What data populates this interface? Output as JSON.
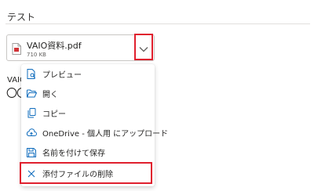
{
  "compose": {
    "subject": "テスト",
    "body_line1": "VAIO",
    "body_line2": "〇〇"
  },
  "attachment": {
    "name": "VAIO資料.pdf",
    "size": "710 KB",
    "icon": "pdf-file-icon"
  },
  "menu": {
    "items": [
      {
        "label": "プレビュー",
        "icon": "preview-icon"
      },
      {
        "label": "開く",
        "icon": "folder-open-icon"
      },
      {
        "label": "コピー",
        "icon": "copy-icon"
      },
      {
        "label": "OneDrive - 個人用 にアップロード",
        "icon": "cloud-upload-icon"
      },
      {
        "label": "名前を付けて保存",
        "icon": "save-icon"
      },
      {
        "label": "添付ファイルの削除",
        "icon": "close-icon"
      }
    ]
  },
  "colors": {
    "accent": "#0f6cbd",
    "highlight": "#e0202e",
    "pdf_red": "#d13438"
  }
}
